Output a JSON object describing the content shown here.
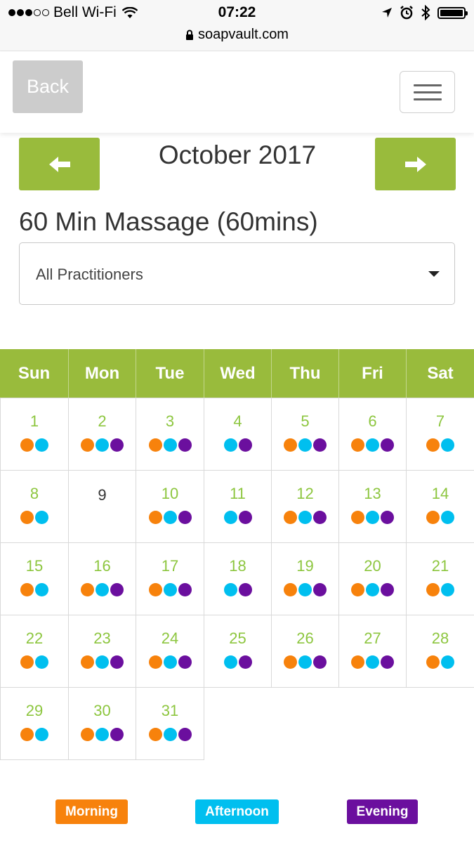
{
  "status_bar": {
    "carrier": "Bell Wi-Fi",
    "time": "07:22",
    "url": "soapvault.com",
    "signal_icon": "signal-dots-icon",
    "wifi_icon": "wifi-icon",
    "battery_level": 1.0
  },
  "header": {
    "back_label": "Back",
    "menu_icon": "hamburger-menu-icon"
  },
  "calendar_nav": {
    "month": "October 2017",
    "prev_icon": "arrow-left-icon",
    "next_icon": "arrow-right-icon"
  },
  "service": {
    "title": "60 Min Massage (60mins)"
  },
  "practitioner_select": {
    "value": "All Practitioners"
  },
  "weekdays": [
    "Sun",
    "Mon",
    "Tue",
    "Wed",
    "Thu",
    "Fri",
    "Sat"
  ],
  "days": [
    {
      "day": "1",
      "slots": [
        "m",
        "a"
      ]
    },
    {
      "day": "2",
      "slots": [
        "m",
        "a",
        "e"
      ]
    },
    {
      "day": "3",
      "slots": [
        "m",
        "a",
        "e"
      ]
    },
    {
      "day": "4",
      "slots": [
        "a",
        "e"
      ]
    },
    {
      "day": "5",
      "slots": [
        "m",
        "a",
        "e"
      ]
    },
    {
      "day": "6",
      "slots": [
        "m",
        "a",
        "e"
      ]
    },
    {
      "day": "7",
      "slots": [
        "m",
        "a"
      ]
    },
    {
      "day": "8",
      "slots": [
        "m",
        "a"
      ]
    },
    {
      "day": "9",
      "slots": []
    },
    {
      "day": "10",
      "slots": [
        "m",
        "a",
        "e"
      ]
    },
    {
      "day": "11",
      "slots": [
        "a",
        "e"
      ]
    },
    {
      "day": "12",
      "slots": [
        "m",
        "a",
        "e"
      ]
    },
    {
      "day": "13",
      "slots": [
        "m",
        "a",
        "e"
      ]
    },
    {
      "day": "14",
      "slots": [
        "m",
        "a"
      ]
    },
    {
      "day": "15",
      "slots": [
        "m",
        "a"
      ]
    },
    {
      "day": "16",
      "slots": [
        "m",
        "a",
        "e"
      ]
    },
    {
      "day": "17",
      "slots": [
        "m",
        "a",
        "e"
      ]
    },
    {
      "day": "18",
      "slots": [
        "a",
        "e"
      ]
    },
    {
      "day": "19",
      "slots": [
        "m",
        "a",
        "e"
      ]
    },
    {
      "day": "20",
      "slots": [
        "m",
        "a",
        "e"
      ]
    },
    {
      "day": "21",
      "slots": [
        "m",
        "a"
      ]
    },
    {
      "day": "22",
      "slots": [
        "m",
        "a"
      ]
    },
    {
      "day": "23",
      "slots": [
        "m",
        "a",
        "e"
      ]
    },
    {
      "day": "24",
      "slots": [
        "m",
        "a",
        "e"
      ]
    },
    {
      "day": "25",
      "slots": [
        "a",
        "e"
      ]
    },
    {
      "day": "26",
      "slots": [
        "m",
        "a",
        "e"
      ]
    },
    {
      "day": "27",
      "slots": [
        "m",
        "a",
        "e"
      ]
    },
    {
      "day": "28",
      "slots": [
        "m",
        "a"
      ]
    },
    {
      "day": "29",
      "slots": [
        "m",
        "a"
      ]
    },
    {
      "day": "30",
      "slots": [
        "m",
        "a",
        "e"
      ]
    },
    {
      "day": "31",
      "slots": [
        "m",
        "a",
        "e"
      ]
    }
  ],
  "legend": {
    "morning": "Morning",
    "afternoon": "Afternoon",
    "evening": "Evening"
  },
  "colors": {
    "accent_green": "#99bb3c",
    "day_number_green": "#8dc63f",
    "morning": "#f7820c",
    "afternoon": "#00bfef",
    "evening": "#6b0f9e",
    "back_button": "#cccccc"
  }
}
